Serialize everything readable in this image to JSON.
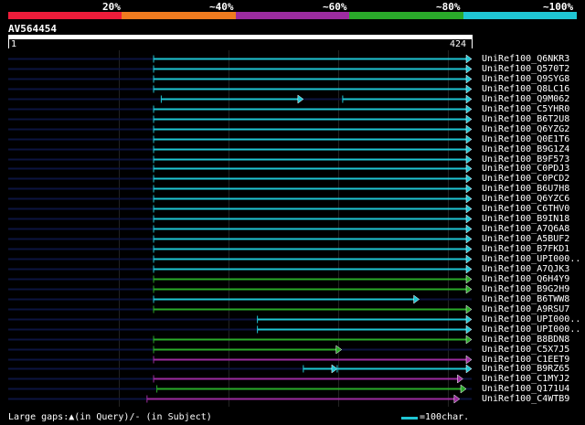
{
  "header": {
    "pct_labels": [
      "20%",
      "~40%",
      "~60%",
      "~80%",
      "~100%"
    ],
    "colors": [
      "#ee1c3a",
      "#ef7b1f",
      "#9c2ca0",
      "#2aaa2a",
      "#1fc6d4"
    ]
  },
  "query": {
    "name": "AV564454",
    "start": "1",
    "end": "424",
    "length": 424
  },
  "hits": [
    {
      "label": "UniRef100_Q6NKR3",
      "color": "#1fc6d4",
      "segments": [
        [
          133,
          424
        ]
      ]
    },
    {
      "label": "UniRef100_Q570T2",
      "color": "#1fc6d4",
      "segments": [
        [
          133,
          424
        ]
      ]
    },
    {
      "label": "UniRef100_Q9SYG8",
      "color": "#1fc6d4",
      "segments": [
        [
          133,
          424
        ]
      ]
    },
    {
      "label": "UniRef100_Q8LC16",
      "color": "#1fc6d4",
      "segments": [
        [
          133,
          424
        ]
      ]
    },
    {
      "label": "UniRef100_Q9M062",
      "color": "#1fc6d4",
      "segments": [
        [
          140,
          270
        ],
        [
          306,
          424
        ]
      ]
    },
    {
      "label": "UniRef100_C5YHR0",
      "color": "#1fc6d4",
      "segments": [
        [
          133,
          424
        ]
      ]
    },
    {
      "label": "UniRef100_B6T2U8",
      "color": "#1fc6d4",
      "segments": [
        [
          133,
          424
        ]
      ]
    },
    {
      "label": "UniRef100_Q6YZG2",
      "color": "#1fc6d4",
      "segments": [
        [
          133,
          424
        ]
      ]
    },
    {
      "label": "UniRef100_Q0E1T6",
      "color": "#1fc6d4",
      "segments": [
        [
          133,
          424
        ]
      ]
    },
    {
      "label": "UniRef100_B9G1Z4",
      "color": "#1fc6d4",
      "segments": [
        [
          133,
          424
        ]
      ]
    },
    {
      "label": "UniRef100_B9F573",
      "color": "#1fc6d4",
      "segments": [
        [
          133,
          424
        ]
      ]
    },
    {
      "label": "UniRef100_C0PDJ3",
      "color": "#1fc6d4",
      "segments": [
        [
          133,
          424
        ]
      ]
    },
    {
      "label": "UniRef100_C0PCD2",
      "color": "#1fc6d4",
      "segments": [
        [
          133,
          424
        ]
      ]
    },
    {
      "label": "UniRef100_B6U7H8",
      "color": "#1fc6d4",
      "segments": [
        [
          133,
          424
        ]
      ]
    },
    {
      "label": "UniRef100_Q6YZC6",
      "color": "#1fc6d4",
      "segments": [
        [
          133,
          424
        ]
      ]
    },
    {
      "label": "UniRef100_C6THV0",
      "color": "#1fc6d4",
      "segments": [
        [
          133,
          424
        ]
      ]
    },
    {
      "label": "UniRef100_B9IN18",
      "color": "#1fc6d4",
      "segments": [
        [
          133,
          424
        ]
      ]
    },
    {
      "label": "UniRef100_A7Q6A8",
      "color": "#1fc6d4",
      "segments": [
        [
          133,
          424
        ]
      ]
    },
    {
      "label": "UniRef100_A5BUF2",
      "color": "#1fc6d4",
      "segments": [
        [
          133,
          424
        ]
      ]
    },
    {
      "label": "UniRef100_B7FKD1",
      "color": "#1fc6d4",
      "segments": [
        [
          133,
          424
        ]
      ]
    },
    {
      "label": "UniRef100_UPI000..",
      "color": "#1fc6d4",
      "segments": [
        [
          133,
          424
        ]
      ]
    },
    {
      "label": "UniRef100_A7QJK3",
      "color": "#1fc6d4",
      "segments": [
        [
          133,
          424
        ]
      ]
    },
    {
      "label": "UniRef100_Q6H4Y9",
      "color": "#2aaa2a",
      "segments": [
        [
          133,
          424
        ]
      ]
    },
    {
      "label": "UniRef100_B9G2H9",
      "color": "#2aaa2a",
      "segments": [
        [
          133,
          424
        ]
      ]
    },
    {
      "label": "UniRef100_B6TWW8",
      "color": "#1fc6d4",
      "segments": [
        [
          133,
          376
        ]
      ]
    },
    {
      "label": "UniRef100_A9RSU7",
      "color": "#2aaa2a",
      "segments": [
        [
          133,
          424
        ]
      ]
    },
    {
      "label": "UniRef100_UPI000..",
      "color": "#1fc6d4",
      "segments": [
        [
          228,
          424
        ]
      ]
    },
    {
      "label": "UniRef100_UPI000..",
      "color": "#1fc6d4",
      "segments": [
        [
          228,
          424
        ]
      ]
    },
    {
      "label": "UniRef100_B8BDN8",
      "color": "#2aaa2a",
      "segments": [
        [
          133,
          424
        ]
      ]
    },
    {
      "label": "UniRef100_C5X7J5",
      "color": "#2aaa2a",
      "segments": [
        [
          133,
          305
        ]
      ]
    },
    {
      "label": "UniRef100_C1EET9",
      "color": "#9c2ca0",
      "segments": [
        [
          133,
          424
        ]
      ]
    },
    {
      "label": "UniRef100_B9RZ65",
      "color": "#1fc6d4",
      "segments": [
        [
          270,
          301
        ],
        [
          301,
          424
        ]
      ]
    },
    {
      "label": "UniRef100_C1MYJ2",
      "color": "#9c2ca0",
      "segments": [
        [
          133,
          416
        ]
      ]
    },
    {
      "label": "UniRef100_Q171U4",
      "color": "#2aaa2a",
      "segments": [
        [
          136,
          419
        ]
      ]
    },
    {
      "label": "UniRef100_C4WTB9",
      "color": "#9c2ca0",
      "segments": [
        [
          127,
          413
        ]
      ]
    }
  ],
  "footer": {
    "gaps_text": "Large gaps:▲(in Query)/- (in Subject)",
    "scale_text": "=100char."
  }
}
